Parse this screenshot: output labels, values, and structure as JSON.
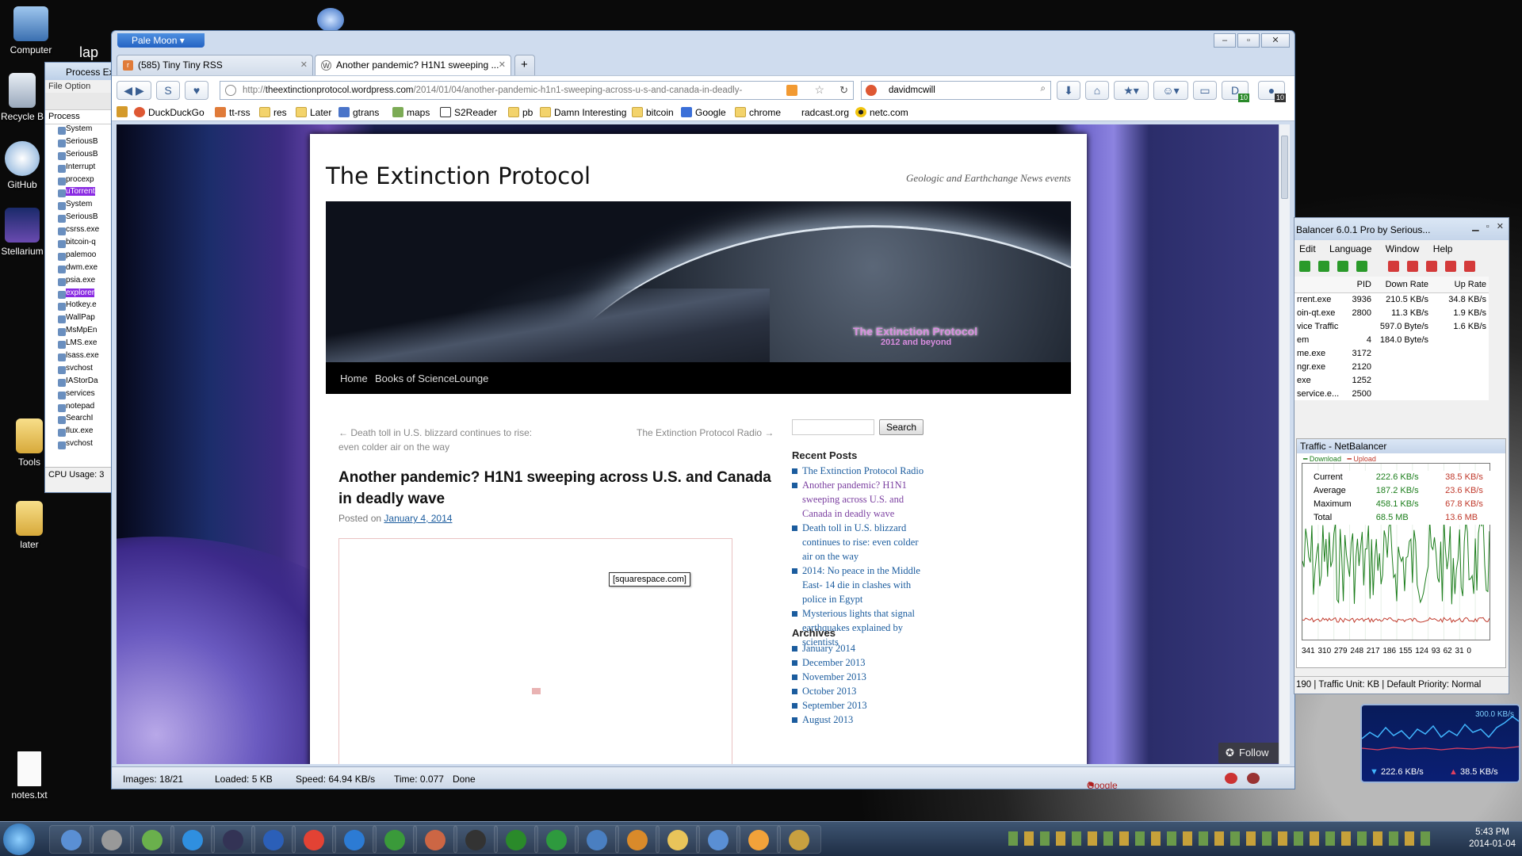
{
  "desktop": {
    "icons": [
      "Computer",
      "Recycle B",
      "GitHub",
      "Stellarium",
      "Tools",
      "later",
      "notes.txt"
    ],
    "lap": "lap"
  },
  "process_explorer": {
    "title": "Process Ex",
    "menu": "File  Option",
    "header": "Process",
    "rows": [
      "System",
      "SeriousB",
      "SeriousB",
      "Interrupt",
      "procexp",
      "uTorrent",
      "System",
      "SeriousB",
      "csrss.exe",
      "bitcoin-q",
      "palemoo",
      "dwm.exe",
      "psia.exe",
      "explorer",
      "Hotkey.e",
      "WallPap",
      "MsMpEn",
      "LMS.exe",
      "lsass.exe",
      "svchost",
      "IAStorDa",
      "services",
      "notepad",
      "SearchI",
      "flux.exe",
      "svchost"
    ],
    "status": "CPU Usage: 3"
  },
  "browser": {
    "app_button": "Pale Moon",
    "tabs": [
      {
        "label": "(585) Tiny Tiny RSS"
      },
      {
        "label": "Another pandemic? H1N1 sweeping ..."
      }
    ],
    "new_tab": "+",
    "url_prefix": "http://",
    "url_domain": "theextinctionprotocol.wordpress.com",
    "url_path": "/2014/01/04/another-pandemic-h1n1-sweeping-across-u-s-and-canada-in-deadly-",
    "search_text": "davidmcwill",
    "badge_download": "10",
    "badge_ext": "10",
    "bookmarks": [
      "DuckDuckGo",
      "tt-rss",
      "res",
      "Later",
      "gtrans",
      "maps",
      "S2Reader",
      "pb",
      "Damn Interesting",
      "bitcoin",
      "Google",
      "chrome",
      "radcast.org",
      "netc.com"
    ],
    "status": {
      "images": "Images: 18/21",
      "loaded": "Loaded: 5 KB",
      "speed": "Speed: 64.94 KB/s",
      "time": "Time: 0.077",
      "done": "Done",
      "sharing": "Google Sharing Disabled"
    }
  },
  "site": {
    "title": "The Extinction Protocol",
    "description": "Geologic and Earthchange News events",
    "banner_text": "The Extinction Protocol",
    "banner_sub": "2012 and beyond",
    "nav": [
      "Home",
      "Books of Science",
      "Lounge"
    ],
    "prev_post": "← Death toll in U.S. blizzard continues to rise: even colder air on the way",
    "next_post": "The Extinction Protocol Radio →",
    "post_title": "Another pandemic? H1N1 sweeping across U.S. and Canada in deadly wave",
    "posted_on": "Posted on",
    "post_date": "January 4, 2014",
    "embed_label": "[squarespace.com]",
    "search_button": "Search",
    "recent_title": "Recent Posts",
    "recent": [
      "The Extinction Protocol Radio",
      "Another pandemic? H1N1 sweeping across U.S. and Canada in deadly wave",
      "Death toll in U.S. blizzard continues to rise: even colder air on the way",
      "2014: No peace in the Middle East- 14 die in clashes with police in Egypt",
      "Mysterious lights that signal earthquakes explained by scientists"
    ],
    "archives_title": "Archives",
    "archives": [
      "January 2014",
      "December 2013",
      "November 2013",
      "October 2013",
      "September 2013",
      "August 2013"
    ],
    "follow": "Follow"
  },
  "netbalancer": {
    "title": "Balancer 6.0.1 Pro by Serious...",
    "menu": [
      "Edit",
      "Language",
      "Window",
      "Help"
    ],
    "columns": [
      "",
      "PID",
      "Down Rate",
      "Up Rate"
    ],
    "rows": [
      [
        "rrent.exe",
        "3936",
        "210.5 KB/s",
        "34.8 KB/s"
      ],
      [
        "oin-qt.exe",
        "2800",
        "11.3 KB/s",
        "1.9 KB/s"
      ],
      [
        "vice Traffic",
        "",
        "597.0 Byte/s",
        "1.6 KB/s"
      ],
      [
        "em",
        "4",
        "184.0 Byte/s",
        ""
      ],
      [
        "me.exe",
        "3172",
        "",
        ""
      ],
      [
        "ngr.exe",
        "2120",
        "",
        ""
      ],
      [
        "exe",
        "1252",
        "",
        ""
      ],
      [
        "service.e...",
        "2500",
        "",
        ""
      ]
    ],
    "traffic_title": "Traffic - NetBalancer",
    "legend": [
      "Download",
      "Upload"
    ],
    "stats": [
      [
        "Current",
        "222.6 KB/s",
        "38.5 KB/s"
      ],
      [
        "Average",
        "187.2 KB/s",
        "23.6 KB/s"
      ],
      [
        "Maximum",
        "458.1 KB/s",
        "67.8 KB/s"
      ],
      [
        "Total",
        "68.5 MB",
        "13.6 MB"
      ]
    ],
    "xaxis": "341 310 279 248 217 186 155 124 93 62 31 0",
    "status": [
      "190",
      "Traffic Unit: KB",
      "Default Priority: Normal"
    ]
  },
  "mini_widget": {
    "peak": "300.0 KB/s",
    "down": "222.6 KB/s",
    "up": "38.5 KB/s"
  },
  "clock": {
    "time": "5:43 PM",
    "date": "2014-01-04"
  },
  "colors": {
    "link": "#1b5c9e",
    "download": "#1b7d1b",
    "upload": "#c0392b"
  }
}
